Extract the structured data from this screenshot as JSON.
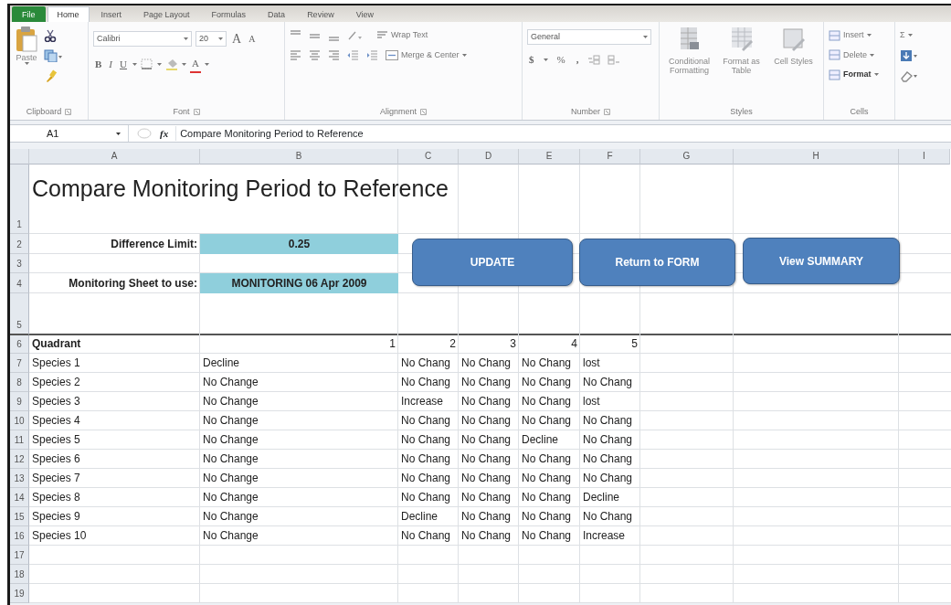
{
  "ribbon_tabs": [
    {
      "label": "File",
      "kind": "file",
      "selected": false
    },
    {
      "label": "Home",
      "kind": "tab",
      "selected": true
    },
    {
      "label": "Insert",
      "kind": "tab",
      "selected": false
    },
    {
      "label": "Page Layout",
      "kind": "tab",
      "selected": false
    },
    {
      "label": "Formulas",
      "kind": "tab",
      "selected": false
    },
    {
      "label": "Data",
      "kind": "tab",
      "selected": false
    },
    {
      "label": "Review",
      "kind": "tab",
      "selected": false
    },
    {
      "label": "View",
      "kind": "tab",
      "selected": false
    }
  ],
  "ribbon": {
    "clipboard": {
      "label": "Clipboard",
      "paste": "Paste"
    },
    "font": {
      "label": "Font",
      "name": "Calibri",
      "size": "20",
      "grow": "A",
      "shrink": "A",
      "bold": "B",
      "italic": "I",
      "underline": "U",
      "font_color": "A"
    },
    "alignment": {
      "label": "Alignment",
      "wrap": "Wrap Text",
      "merge": "Merge & Center"
    },
    "number": {
      "label": "Number",
      "format": "General",
      "currency": "$",
      "percent": "%",
      "comma": ","
    },
    "styles": {
      "label": "Styles",
      "items": [
        "Conditional Formatting",
        "Format as Table",
        "Cell Styles"
      ]
    },
    "cells": {
      "label": "Cells",
      "items": [
        "Insert",
        "Delete",
        "Format"
      ]
    },
    "editing": {
      "sum": "Σ"
    }
  },
  "formula_bar": {
    "name_box": "A1",
    "fx": "fx",
    "formula": "Compare Monitoring Period to Reference"
  },
  "sheet": {
    "columns": [
      "A",
      "B",
      "C",
      "D",
      "E",
      "F",
      "G",
      "H",
      "I"
    ],
    "rows": [
      {
        "number": "1",
        "kind": "title",
        "cells": [
          "Compare Monitoring Period to Reference"
        ]
      },
      {
        "number": "2",
        "kind": "param",
        "cells": [
          "Difference Limit:",
          "0.25"
        ]
      },
      {
        "number": "3",
        "kind": "empty",
        "cells": []
      },
      {
        "number": "4",
        "kind": "param",
        "cells": [
          "Monitoring Sheet to use:",
          "MONITORING 06 Apr 2009"
        ]
      },
      {
        "number": "5",
        "kind": "empty",
        "cells": []
      },
      {
        "number": "6",
        "kind": "header",
        "cells": [
          "Quadrant",
          "1",
          "2",
          "3",
          "4",
          "5"
        ]
      },
      {
        "number": "7",
        "kind": "data",
        "cells": [
          "Species 1",
          "Decline",
          "No Chang",
          "No Chang",
          "No Chang",
          "lost"
        ]
      },
      {
        "number": "8",
        "kind": "data",
        "cells": [
          "Species 2",
          "No Change",
          "No Chang",
          "No Chang",
          "No Chang",
          "No Chang"
        ]
      },
      {
        "number": "9",
        "kind": "data",
        "cells": [
          "Species 3",
          "No Change",
          "Increase",
          "No Chang",
          "No Chang",
          "lost"
        ]
      },
      {
        "number": "10",
        "kind": "data",
        "cells": [
          "Species 4",
          "No Change",
          "No Chang",
          "No Chang",
          "No Chang",
          "No Chang"
        ]
      },
      {
        "number": "11",
        "kind": "data",
        "cells": [
          "Species 5",
          "No Change",
          "No Chang",
          "No Chang",
          "Decline",
          "No Chang"
        ]
      },
      {
        "number": "12",
        "kind": "data",
        "cells": [
          "Species 6",
          "No Change",
          "No Chang",
          "No Chang",
          "No Chang",
          "No Chang"
        ]
      },
      {
        "number": "13",
        "kind": "data",
        "cells": [
          "Species 7",
          "No Change",
          "No Chang",
          "No Chang",
          "No Chang",
          "No Chang"
        ]
      },
      {
        "number": "14",
        "kind": "data",
        "cells": [
          "Species 8",
          "No Change",
          "No Chang",
          "No Chang",
          "No Chang",
          "Decline"
        ]
      },
      {
        "number": "15",
        "kind": "data",
        "cells": [
          "Species 9",
          "No Change",
          "Decline",
          "No Chang",
          "No Chang",
          "No Chang"
        ]
      },
      {
        "number": "16",
        "kind": "data",
        "cells": [
          "Species 10",
          "No Change",
          "No Chang",
          "No Chang",
          "No Chang",
          "Increase"
        ]
      },
      {
        "number": "17",
        "kind": "empty",
        "cells": []
      },
      {
        "number": "18",
        "kind": "empty",
        "cells": []
      },
      {
        "number": "19",
        "kind": "empty",
        "cells": []
      }
    ],
    "buttons": [
      "UPDATE",
      "Return to FORM",
      "View SUMMARY"
    ]
  }
}
